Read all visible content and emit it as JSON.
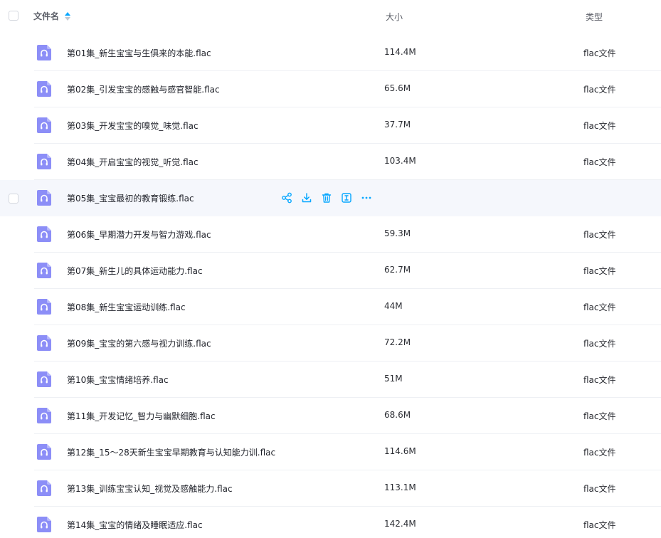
{
  "header": {
    "name_label": "文件名",
    "size_label": "大小",
    "type_label": "类型"
  },
  "accent_color": "#06a7ff",
  "icon_color": "#8c8ef7",
  "actions": [
    "share-icon",
    "download-icon",
    "delete-icon",
    "rename-icon",
    "more-icon"
  ],
  "files": [
    {
      "name": "第01集_新生宝宝与生俱来的本能.flac",
      "size": "114.4M",
      "type": "flac文件"
    },
    {
      "name": "第02集_引发宝宝的感触与感官智能.flac",
      "size": "65.6M",
      "type": "flac文件"
    },
    {
      "name": "第03集_开发宝宝的嗅觉_味觉.flac",
      "size": "37.7M",
      "type": "flac文件"
    },
    {
      "name": "第04集_开启宝宝的视觉_听觉.flac",
      "size": "103.4M",
      "type": "flac文件"
    },
    {
      "name": "第05集_宝宝最初的教育锻练.flac",
      "size": "",
      "type": "",
      "hovered": true
    },
    {
      "name": "第06集_早期潜力开发与智力游戏.flac",
      "size": "59.3M",
      "type": "flac文件"
    },
    {
      "name": "第07集_新生儿的具体运动能力.flac",
      "size": "62.7M",
      "type": "flac文件"
    },
    {
      "name": "第08集_新生宝宝运动训练.flac",
      "size": "44M",
      "type": "flac文件"
    },
    {
      "name": "第09集_宝宝的第六感与视力训练.flac",
      "size": "72.2M",
      "type": "flac文件"
    },
    {
      "name": "第10集_宝宝情绪培养.flac",
      "size": "51M",
      "type": "flac文件"
    },
    {
      "name": "第11集_开发记忆_智力与幽默细胞.flac",
      "size": "68.6M",
      "type": "flac文件"
    },
    {
      "name": "第12集_15～28天新生宝宝早期教育与认知能力训.flac",
      "size": "114.6M",
      "type": "flac文件"
    },
    {
      "name": "第13集_训练宝宝认知_视觉及感触能力.flac",
      "size": "113.1M",
      "type": "flac文件"
    },
    {
      "name": "第14集_宝宝的情绪及睡眠适应.flac",
      "size": "142.4M",
      "type": "flac文件"
    }
  ]
}
